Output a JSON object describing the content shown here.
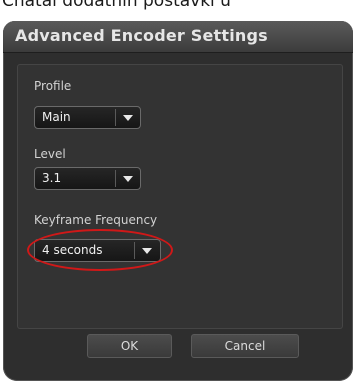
{
  "page_header": {
    "partial_text": "Chatal dodatnih postavki u"
  },
  "dialog": {
    "title": "Advanced Encoder Settings",
    "fields": {
      "profile": {
        "label": "Profile",
        "value": "Main"
      },
      "level": {
        "label": "Level",
        "value": "3.1"
      },
      "keyframe_frequency": {
        "label": "Keyframe Frequency",
        "value": "4 seconds"
      }
    },
    "buttons": {
      "ok": "OK",
      "cancel": "Cancel"
    }
  },
  "highlight": {
    "target": "keyframe-frequency-select",
    "color": "#d01818"
  },
  "colors": {
    "dialog_bg": "#2e2e2e",
    "panel_bg": "#333333",
    "title_text": "#e6e6e6",
    "label_text": "#d2d2d2"
  },
  "icons": {
    "dropdown": "chevron-down-icon"
  }
}
